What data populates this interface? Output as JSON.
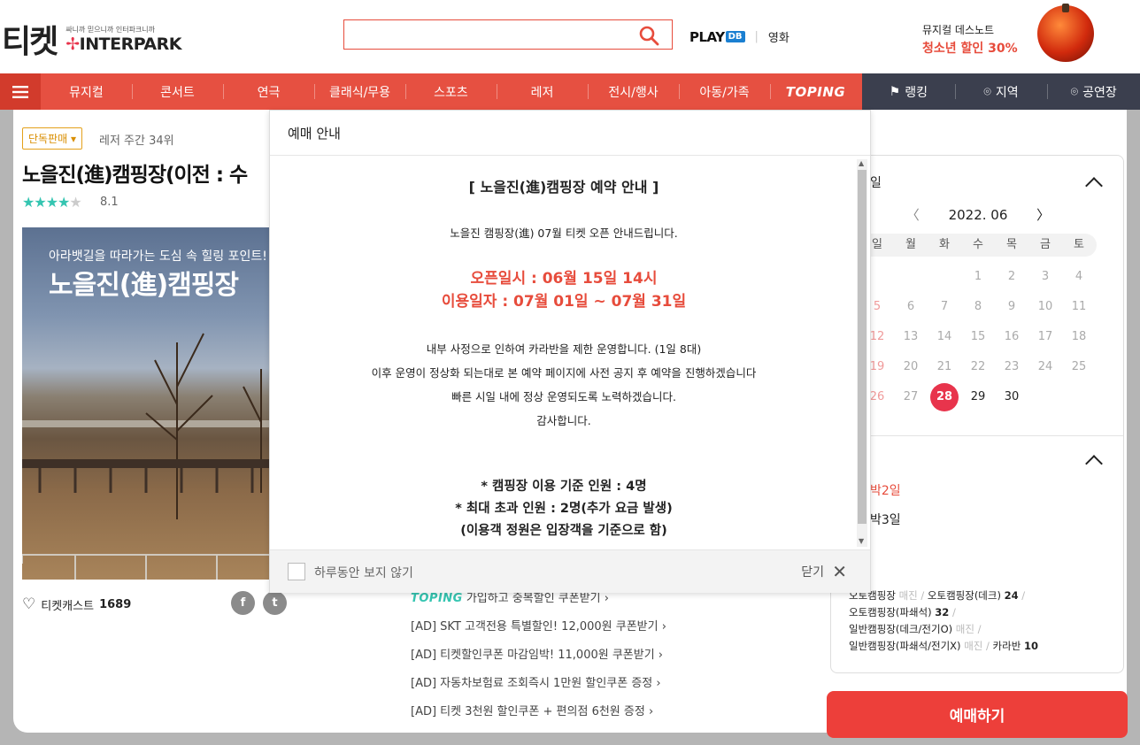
{
  "header": {
    "logo_ticket": "티켓",
    "logo_tagline": "싸니까 믿으니까 인터파크니까",
    "logo_brand": "INTERPARK",
    "search_placeholder": "",
    "playdb_label": "PLAY",
    "playdb_badge": "DB",
    "movie_link": "영화",
    "promo_line1": "뮤지컬 데스노트",
    "promo_line2": "청소년 할인 30%"
  },
  "nav": {
    "items": [
      "뮤지컬",
      "콘서트",
      "연극",
      "클래식/무용",
      "스포츠",
      "레저",
      "전시/행사",
      "아동/가족",
      "TOPING"
    ],
    "right": [
      "랭킹",
      "지역",
      "공연장"
    ]
  },
  "product": {
    "badge": "단독판매 ▾",
    "rank": "레저 주간 34위",
    "title": "노을진(進)캠핑장(이전 : 수",
    "stars_on": "★★★★",
    "stars_off": "★",
    "rating": 4.1,
    "score": "8.1",
    "poster_sub": "아라뱃길을 따라가는 도심 속 힐링 포인트!",
    "poster_title": "노을진(進)캠핑장",
    "cast_label": "티켓캐스트",
    "cast_count": "1689",
    "share_fb": "f",
    "share_tw": "t"
  },
  "coupons": {
    "toping_word": "TOPING",
    "toping_text": "가입하고 중복할인 쿠폰받기 ›",
    "ads": [
      "[AD] SKT 고객전용 특별할인! 12,000원 쿠폰받기 ›",
      "[AD] 티켓할인쿠폰 마감임박! 11,000원 쿠폰받기 ›",
      "[AD] 자동차보험료 조회즉시 1만원 할인쿠폰 증정 ›",
      "[AD] 티켓 3천원 할인쿠폰 + 편의점 6천원 증정 ›"
    ]
  },
  "calendar": {
    "section_title": "일",
    "month": "2022. 06",
    "prev": "〈",
    "next": "〉",
    "dow": [
      "일",
      "월",
      "화",
      "수",
      "목",
      "금",
      "토"
    ],
    "weeks": [
      [
        "",
        "",
        "",
        "1",
        "2",
        "3",
        "4"
      ],
      [
        "5",
        "6",
        "7",
        "8",
        "9",
        "10",
        "11"
      ],
      [
        "12",
        "13",
        "14",
        "15",
        "16",
        "17",
        "18"
      ],
      [
        "19",
        "20",
        "21",
        "22",
        "23",
        "24",
        "25"
      ],
      [
        "26",
        "27",
        "28",
        "29",
        "30",
        "",
        ""
      ]
    ],
    "selected": "28",
    "colors": {
      "selected": "#e8344c",
      "sunday": "#f09a9a",
      "past": "#aaaaaa"
    }
  },
  "options": {
    "section_title": "",
    "opt1": "박2일",
    "opt2": "박3일",
    "seats_line1_a": "오토캠핑장",
    "seats_line1_a_status": "매진",
    "seats_line1_b": "오토캠핑장(데크)",
    "seats_line1_b_count": "24",
    "seats_line2": "오토캠핑장(파쇄석)",
    "seats_line2_count": "32",
    "seats_line3": "일반캠핑장(데크/전기O)",
    "seats_line3_status": "매진",
    "seats_line4": "일반캠핑장(파쇄석/전기X)",
    "seats_line4_status": "매진",
    "seats_line4_b": "카라반",
    "seats_line4_b_count": "10",
    "sep": "/"
  },
  "buy_button": "예매하기",
  "modal": {
    "header": "예매 안내",
    "title": "[ 노을진(進)캠핑장 예약 안내 ]",
    "open_notice": "노을진 캠핑장(進) 07월 티켓 오픈 안내드립니다.",
    "open_date": "오픈일시 : 06월 15일 14시",
    "use_date": "이용일자 : 07월 01일 ~ 07월 31일",
    "line1": "내부 사정으로 인하여 카라반을 제한 운영합니다. (1일 8대)",
    "line2": "이후 운영이 정상화 되는대로 본 예약 페이지에 사전 공지 후 예약을 진행하겠습니다",
    "line3": "빠른 시일 내에 정상 운영되도록 노력하겠습니다.",
    "line4": "감사합니다.",
    "rule1": "* 캠핑장 이용 기준 인원 : 4명",
    "rule2": "* 최대 초과 인원 : 2명(추가 요금 발생)",
    "rule3": "(이용객 정원은 입장객을 기준으로 함)",
    "no_show_label": "하루동안 보지 않기",
    "close_label": "닫기"
  }
}
